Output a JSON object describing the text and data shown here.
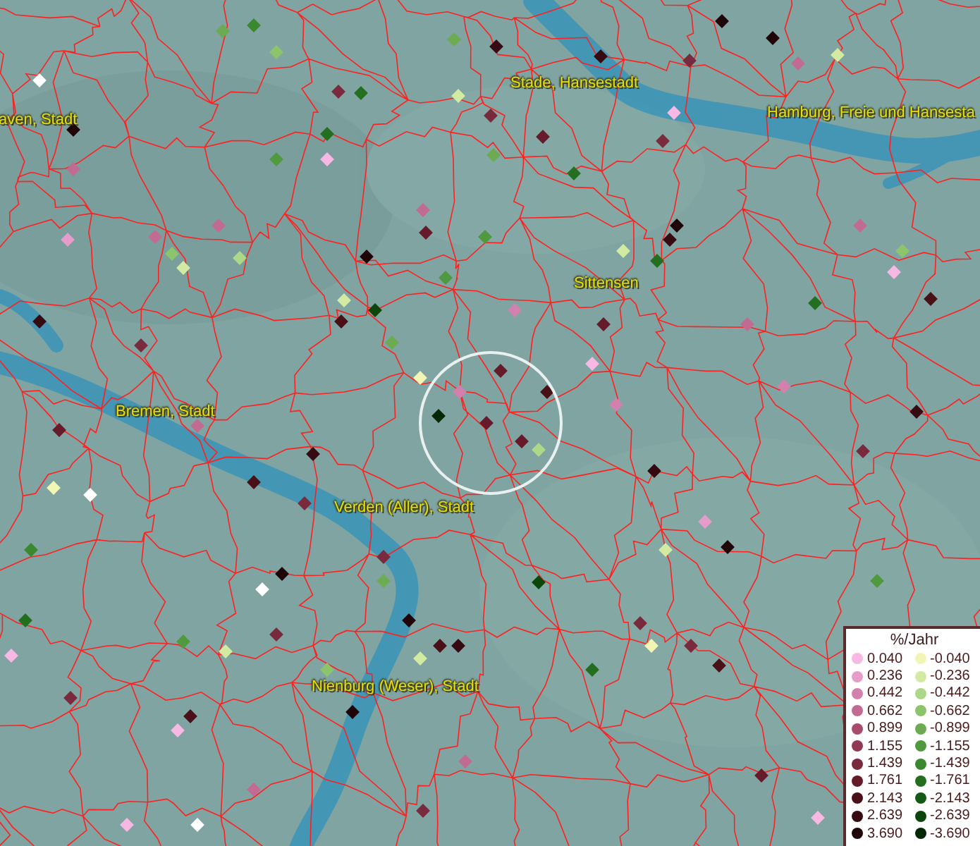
{
  "map": {
    "places": [
      {
        "name": "aven, Stadt"
      },
      {
        "name": "Stade, Hansestadt"
      },
      {
        "name": "Hamburg, Freie und Hansesta"
      },
      {
        "name": "Sittensen"
      },
      {
        "name": "Bremen, Stadt"
      },
      {
        "name": "Verden (Aller), Stadt"
      },
      {
        "name": "Nienburg (Weser), Stadt"
      }
    ]
  },
  "legend": {
    "title": "%/Jahr",
    "rows": [
      {
        "positive": {
          "value": "0.040",
          "color": "#f7b8e4"
        },
        "negative": {
          "value": "-0.040",
          "color": "#f2f6b4"
        }
      },
      {
        "positive": {
          "value": "0.236",
          "color": "#e69ccb"
        },
        "negative": {
          "value": "-0.236",
          "color": "#d2eaa2"
        }
      },
      {
        "positive": {
          "value": "0.442",
          "color": "#d281ae"
        },
        "negative": {
          "value": "-0.442",
          "color": "#acd888"
        }
      },
      {
        "positive": {
          "value": "0.662",
          "color": "#c26b92"
        },
        "negative": {
          "value": "-0.662",
          "color": "#8cc46c"
        }
      },
      {
        "positive": {
          "value": "0.899",
          "color": "#a94b6c"
        },
        "negative": {
          "value": "-0.899",
          "color": "#6cab52"
        }
      },
      {
        "positive": {
          "value": "1.155",
          "color": "#903a53"
        },
        "negative": {
          "value": "-1.155",
          "color": "#4f993e"
        }
      },
      {
        "positive": {
          "value": "1.439",
          "color": "#7a2a3d"
        },
        "negative": {
          "value": "-1.439",
          "color": "#3a8830"
        }
      },
      {
        "positive": {
          "value": "1.761",
          "color": "#651b2a"
        },
        "negative": {
          "value": "-1.761",
          "color": "#246e20"
        }
      },
      {
        "positive": {
          "value": "2.143",
          "color": "#4a1018"
        },
        "negative": {
          "value": "-2.143",
          "color": "#145a14"
        }
      },
      {
        "positive": {
          "value": "2.639",
          "color": "#350a10"
        },
        "negative": {
          "value": "-2.639",
          "color": "#0b460b"
        }
      },
      {
        "positive": {
          "value": "3.690",
          "color": "#1f0408"
        },
        "negative": {
          "value": "-3.690",
          "color": "#032803"
        }
      }
    ]
  }
}
